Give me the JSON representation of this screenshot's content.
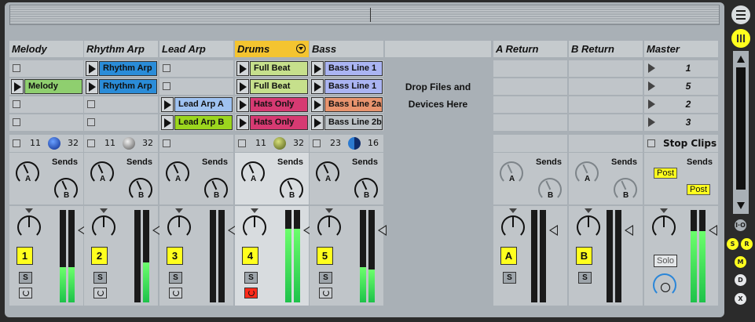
{
  "tracks": [
    {
      "name": "Melody",
      "slots": [
        {
          "type": "stop"
        },
        {
          "type": "clip",
          "label": "Melody",
          "color": "#8fcf6f"
        },
        {
          "type": "stop"
        },
        {
          "type": "stop"
        }
      ],
      "num1": "11",
      "num2": "32",
      "ball": "blue",
      "track_num": "1",
      "solo": "S",
      "arm_on": false,
      "meter": [
        0.38,
        0.38
      ]
    },
    {
      "name": "Rhythm Arp",
      "slots": [
        {
          "type": "clip",
          "label": "Rhythm Arp",
          "color": "#2a8cd8"
        },
        {
          "type": "clip",
          "label": "Rhythm Arp",
          "color": "#2a8cd8"
        },
        {
          "type": "stop"
        },
        {
          "type": "stop"
        }
      ],
      "num1": "11",
      "num2": "32",
      "ball": "grey",
      "track_num": "2",
      "solo": "S",
      "arm_on": false,
      "meter": [
        0.0,
        0.43
      ]
    },
    {
      "name": "Lead Arp",
      "slots": [
        {
          "type": "stop"
        },
        {
          "type": "stop"
        },
        {
          "type": "clip",
          "label": "Lead Arp A",
          "color": "#9fc2f0"
        },
        {
          "type": "clip",
          "label": "Lead Arp B",
          "color": "#9bd61e"
        }
      ],
      "num1": "",
      "num2": "",
      "ball": "",
      "track_num": "3",
      "solo": "S",
      "arm_on": false,
      "meter": [
        0.0,
        0.0
      ]
    },
    {
      "name": "Drums",
      "selected": true,
      "slots": [
        {
          "type": "clip",
          "label": "Full Beat",
          "color": "#c6e08c"
        },
        {
          "type": "clip",
          "label": "Full Beat",
          "color": "#c6e08c"
        },
        {
          "type": "clip",
          "label": "Hats Only",
          "color": "#d63a72"
        },
        {
          "type": "clip",
          "label": "Hats Only",
          "color": "#d63a72"
        }
      ],
      "num1": "11",
      "num2": "32",
      "ball": "olive",
      "track_num": "4",
      "solo": "S",
      "arm_on": true,
      "meter": [
        0.8,
        0.8
      ]
    },
    {
      "name": "Bass",
      "slots": [
        {
          "type": "clip",
          "label": "Bass Line 1",
          "color": "#aab4f2"
        },
        {
          "type": "clip",
          "label": "Bass Line 1",
          "color": "#aab4f2"
        },
        {
          "type": "clip",
          "label": "Bass Line 2a",
          "color": "#e8946e"
        },
        {
          "type": "clip",
          "label": "Bass Line 2b",
          "color": "#bcc2c6"
        }
      ],
      "num1": "23",
      "num2": "16",
      "ball": "split",
      "track_num": "5",
      "solo": "S",
      "arm_on": false,
      "meter": [
        0.38,
        0.36
      ]
    }
  ],
  "drop_area": {
    "line1": "Drop Files and",
    "line2": "Devices Here"
  },
  "returns": [
    {
      "name": "A Return",
      "letter": "A",
      "solo": "S",
      "meter": [
        0.0,
        0.0
      ]
    },
    {
      "name": "B Return",
      "letter": "B",
      "solo": "S",
      "meter": [
        0.0,
        0.0
      ]
    }
  ],
  "master": {
    "name": "Master",
    "scenes": [
      "1",
      "5",
      "2",
      "3"
    ],
    "stop_clips": "Stop Clips",
    "post1": "Post",
    "post2": "Post",
    "solo": "Solo",
    "meter": [
      0.77,
      0.77
    ]
  },
  "sends_label": "Sends",
  "knob_a": "A",
  "knob_b": "B",
  "side_buttons": {
    "io": "I·O",
    "s": "S",
    "r": "R",
    "m": "M",
    "d": "D",
    "x": "X"
  }
}
